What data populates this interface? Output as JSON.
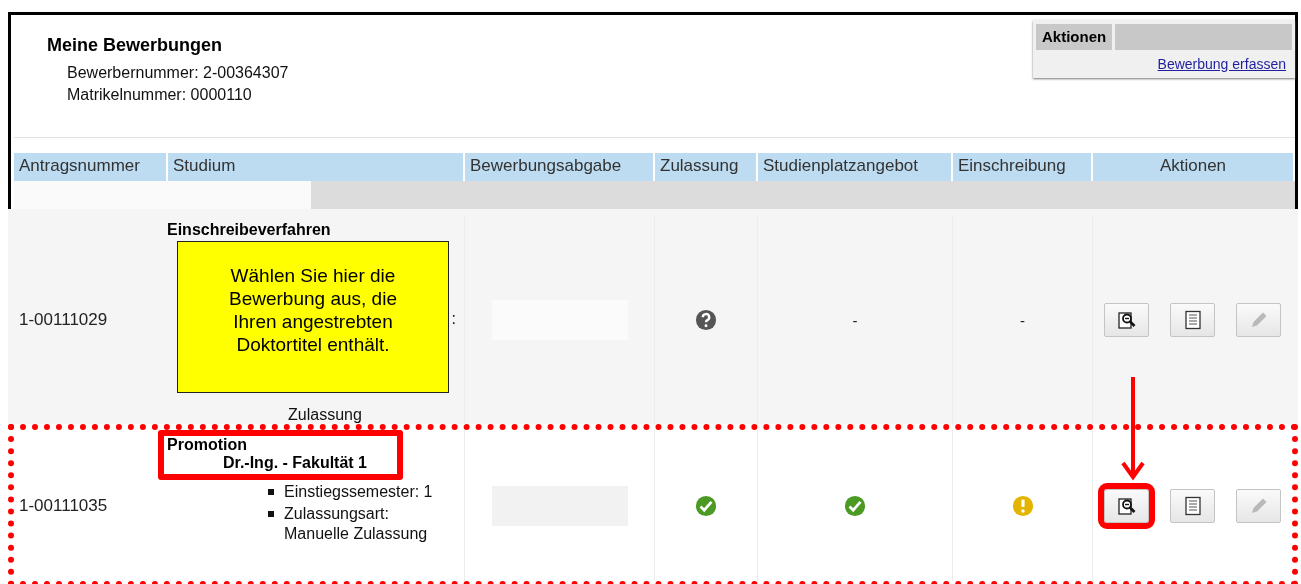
{
  "header": {
    "title": "Meine Bewerbungen",
    "applicant_number": "Bewerbernummer: 2-00364307",
    "matriculation_number": "Matrikelnummer: 0000110"
  },
  "actions_panel": {
    "title": "Aktionen",
    "link": "Bewerbung erfassen"
  },
  "table": {
    "columns": [
      "Antragsnummer",
      "Studium",
      "Bewerbungsabgabe",
      "Zulassung",
      "Studienplatzangebot",
      "Einschreibung",
      "Aktionen"
    ],
    "rows": [
      {
        "number": "1-00111029",
        "highlighted": false,
        "study": {
          "title": "Einschreibeverfahren",
          "highlighted": false,
          "items": [
            {
              "kind": "fragment",
              "text": ":"
            },
            {
              "kind": "continuation",
              "text": "Zulassung"
            }
          ]
        },
        "admission": {
          "kind": "question"
        },
        "offer": {
          "kind": "text",
          "text": "-"
        },
        "enrollment": {
          "kind": "text",
          "text": "-"
        },
        "actions": [
          {
            "kind": "view",
            "highlighted": false
          },
          {
            "kind": "document",
            "highlighted": false
          },
          {
            "kind": "edit",
            "highlighted": false
          }
        ]
      },
      {
        "number": "1-00111035",
        "highlighted": true,
        "study": {
          "title": "Promotion",
          "subtitle": "Dr.-Ing. - Fakultät 1",
          "highlighted": true,
          "items": [
            {
              "kind": "bullet",
              "text": "Einstiegssemester: 1"
            },
            {
              "kind": "bullet",
              "text": "Zulassungsart: Manuelle Zulassung"
            }
          ]
        },
        "admission": {
          "kind": "check"
        },
        "offer": {
          "kind": "check"
        },
        "enrollment": {
          "kind": "warning"
        },
        "actions": [
          {
            "kind": "view",
            "highlighted": true
          },
          {
            "kind": "document",
            "highlighted": false
          },
          {
            "kind": "edit",
            "highlighted": false
          }
        ]
      }
    ]
  },
  "callout": {
    "text": "Wählen Sie hier die Bewerbung aus, die Ihren angestrebten Doktortitel enthält."
  }
}
